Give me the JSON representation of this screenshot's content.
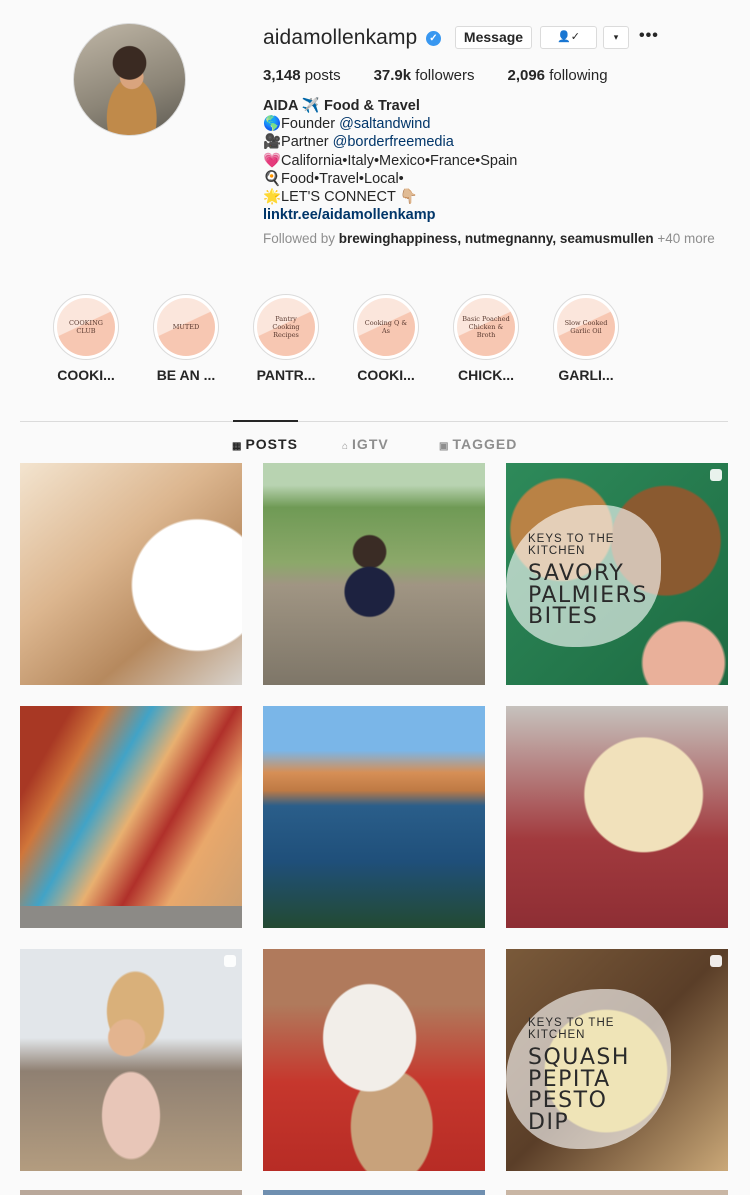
{
  "profile": {
    "username": "aidamollenkamp",
    "buttons": {
      "message": "Message",
      "follow_icon": "👤✓",
      "dropdown": "▾",
      "more": "•••"
    },
    "stats": {
      "posts": "3,148",
      "posts_label": "posts",
      "followers": "37.9k",
      "followers_label": "followers",
      "following": "2,096",
      "following_label": "following"
    },
    "bio": {
      "name": "AIDA ✈️ Food & Travel",
      "line1_prefix": "🌎Founder ",
      "line1_tag": "@saltandwind",
      "line2_prefix": "🎥Partner ",
      "line2_tag": "@borderfreemedia",
      "line3": "💗California•Italy•Mexico•France•Spain",
      "line4": "🍳Food•Travel•Local•",
      "line5": "🌟LET'S CONNECT 👇🏼",
      "link": "linktr.ee/aidamollenkamp"
    },
    "followed_by": {
      "prefix": "Followed by ",
      "users": "brewinghappiness, nutmegnanny, seamusmullen",
      "suffix": " +40 more"
    }
  },
  "highlights": [
    {
      "cover": "COOKING CLUB",
      "label": "COOKI..."
    },
    {
      "cover": "MUTED",
      "label": "BE AN ..."
    },
    {
      "cover": "Pantry Cooking Recipes",
      "label": "PANTR..."
    },
    {
      "cover": "Cooking Q & As",
      "label": "COOKI..."
    },
    {
      "cover": "Basic Poached Chicken & Broth",
      "label": "CHICK..."
    },
    {
      "cover": "Slow Cooked Garlic Oil",
      "label": "GARLI..."
    }
  ],
  "tabs": {
    "posts": "POSTS",
    "igtv": "IGTV",
    "tagged": "TAGGED"
  },
  "posts": [
    {
      "kicker": "KEYS TO THE KITCHEN",
      "title1": "SAVORY",
      "title2": "PALMIERS",
      "title3": "BITES"
    },
    {
      "kicker": "KEYS TO THE KITCHEN",
      "title1": "SQUASH",
      "title2": "PEPITA",
      "title3": "PESTO",
      "title4": "DIP"
    }
  ]
}
